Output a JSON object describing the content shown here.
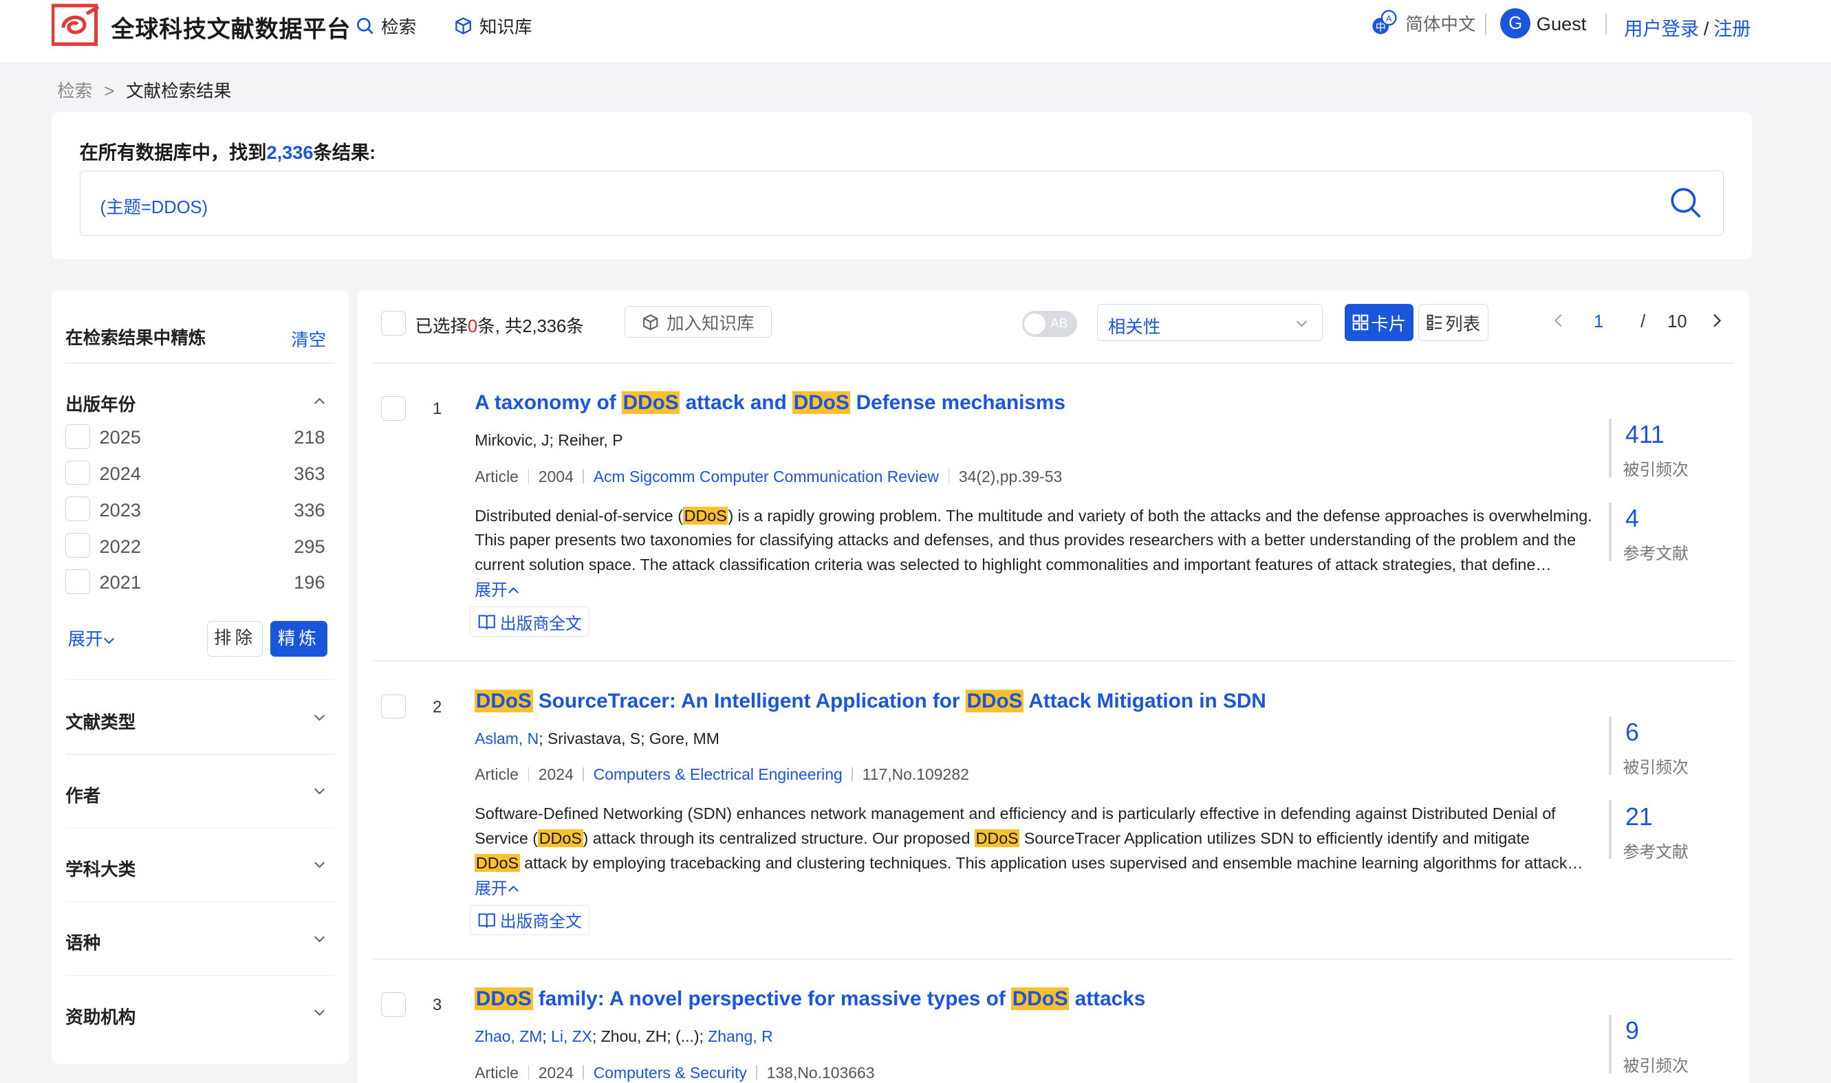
{
  "header": {
    "logo_text": "全球科技文献数据平台",
    "nav_search": "检索",
    "nav_kb": "知识库",
    "language": "简体中文",
    "avatar_letter": "G",
    "user": "Guest",
    "login": "用户登录",
    "slash": "/",
    "register": "注册"
  },
  "breadcrumb": {
    "root": "检索",
    "sep": ">",
    "current": "文献检索结果"
  },
  "search": {
    "found_prefix": "在所有数据库中，找到",
    "found_count": "2,336",
    "found_suffix": "条结果:",
    "query": "(主题=DDOS)"
  },
  "sidebar": {
    "title": "在检索结果中精炼",
    "clear": "清空",
    "year_facet": "出版年份",
    "years": [
      {
        "year": "2025",
        "count": "218"
      },
      {
        "year": "2024",
        "count": "363"
      },
      {
        "year": "2023",
        "count": "336"
      },
      {
        "year": "2022",
        "count": "295"
      },
      {
        "year": "2021",
        "count": "196"
      }
    ],
    "expand": "展开",
    "exclude": "排除",
    "refine": "精炼",
    "facets": [
      "文献类型",
      "作者",
      "学科大类",
      "语种",
      "资助机构"
    ]
  },
  "toolbar": {
    "selected_prefix": "已选择",
    "selected_count": "0",
    "selected_suffix": "条, 共2,336条",
    "add_kb": "加入知识库",
    "toggle_label": "AB",
    "sort": "相关性",
    "card_view": "卡片",
    "list_view": "列表",
    "page_current": "1",
    "page_sep": "/",
    "page_total": "10"
  },
  "records": [
    {
      "index": "1",
      "title_parts": [
        "A taxonomy of ",
        "DDoS",
        " attack and ",
        "DDoS",
        " Defense mechanisms"
      ],
      "authors_plain": "Mirkovic, J; Reiher, P",
      "type": "Article",
      "year": "2004",
      "journal": "Acm Sigcomm Computer Communication Review",
      "volume": "34(2),pp.39-53",
      "abs_l1_a": "Distributed denial-of-service (",
      "abs_l1_hl": "DDoS",
      "abs_l1_b": ") is a rapidly growing problem. The multitude and variety of both the attacks and the defense approaches is overwhelming.",
      "abs_l2": "This paper presents two taxonomies for classifying attacks and defenses, and thus provides researchers with a better understanding of the problem and the",
      "abs_l3": "current solution space. The attack classification criteria was selected to highlight commonalities and important features of attack strategies, that define…",
      "more": "展开",
      "fulltext": "出版商全文",
      "cited": "411",
      "cited_label": "被引频次",
      "refs": "4",
      "refs_label": "参考文献"
    },
    {
      "index": "2",
      "title_parts": [
        "DDoS",
        " SourceTracer: An Intelligent Application for ",
        "DDoS",
        " Attack Mitigation in SDN"
      ],
      "author_link": "Aslam, N",
      "authors_rest": "; Srivastava, S; Gore, MM",
      "type": "Article",
      "year": "2024",
      "journal": "Computers & Electrical Engineering",
      "volume": "117,No.109282",
      "abs_l1": "Software-Defined Networking (SDN) enhances network management and efficiency and is particularly effective in defending against Distributed Denial of",
      "abs_l2_a": "Service (",
      "abs_l2_hl1": "DDoS",
      "abs_l2_b": ") attack through its centralized structure. Our proposed ",
      "abs_l2_hl2": "DDoS",
      "abs_l2_c": " SourceTracer Application utilizes SDN to efficiently identify and mitigate",
      "abs_l3_hl": "DDoS",
      "abs_l3": " attack by employing tracebacking and clustering techniques. This application uses supervised and ensemble machine learning algorithms for attack…",
      "more": "展开",
      "fulltext": "出版商全文",
      "cited": "6",
      "cited_label": "被引频次",
      "refs": "21",
      "refs_label": "参考文献"
    },
    {
      "index": "3",
      "title_parts": [
        "DDoS",
        " family: A novel perspective for massive types of ",
        "DDoS",
        " attacks"
      ],
      "authors": [
        "Zhao, ZM",
        "Li, ZX",
        "Zhou, ZH",
        "(...)",
        "Zhang, R"
      ],
      "type": "Article",
      "year": "2024",
      "journal": "Computers & Security",
      "volume": "138,No.103663",
      "cited": "9",
      "cited_label": "被引频次"
    }
  ],
  "colors": {
    "accent": "#1a56db",
    "highlight": "#fbc02d",
    "logo_red": "#e53935"
  }
}
